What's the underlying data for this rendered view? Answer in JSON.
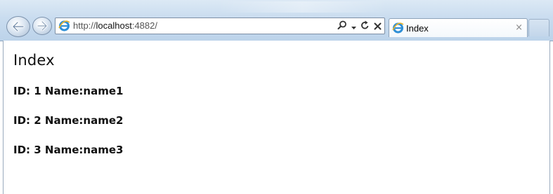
{
  "browser": {
    "address": {
      "protocol": "http://",
      "host": "localhost",
      "port_path": ":4882/"
    },
    "tab": {
      "title": "Index",
      "close_glyph": "×"
    },
    "icons": [
      "back-arrow-icon",
      "forward-arrow-icon",
      "ie-logo-icon",
      "search-icon",
      "dropdown-arrow-icon",
      "refresh-icon",
      "stop-icon",
      "close-icon"
    ]
  },
  "page": {
    "title": "Index",
    "records": [
      {
        "text": "ID: 1 Name:name1"
      },
      {
        "text": "ID: 2 Name:name2"
      },
      {
        "text": "ID: 3 Name:name3"
      }
    ]
  },
  "colors": {
    "chrome_top": "#dce9f5",
    "chrome_bottom": "#bcd3ea",
    "text": "#111111"
  }
}
